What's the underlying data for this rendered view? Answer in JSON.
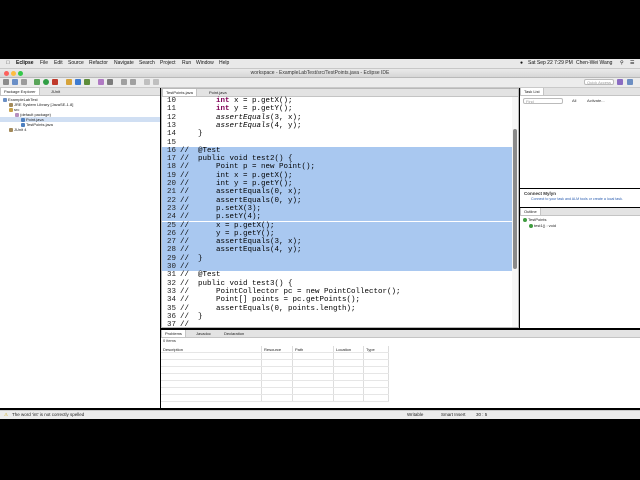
{
  "menubar": {
    "app": "Eclipse",
    "items": [
      "File",
      "Edit",
      "Source",
      "Refactor",
      "Navigate",
      "Search",
      "Project",
      "Run",
      "Window",
      "Help"
    ],
    "datetime": "Sat Sep 22  7:29 PM",
    "user": "Chen-Wei Wang"
  },
  "window": {
    "title": "workspace - ExampleLabTest/src/TestPoints.java - Eclipse IDE"
  },
  "toolbar": {
    "quick_access": "Quick Access"
  },
  "package_explorer": {
    "tab_label": "Package Explorer",
    "tab2_label": "JUnit",
    "tree": [
      "ExampleLabTest",
      "JRE System Library [JavaSE-1.8]",
      "src",
      "(default package)",
      "Point.java",
      "TestPoints.java",
      "JUnit 4"
    ]
  },
  "editor": {
    "tabs": [
      "TestPoints.java",
      "Point.java"
    ],
    "lines": [
      {
        "n": "10",
        "t": "        int x = p.getX();"
      },
      {
        "n": "11",
        "t": "        int y = p.getY();"
      },
      {
        "n": "12",
        "t": "        assertEquals(3, x);"
      },
      {
        "n": "13",
        "t": "        assertEquals(4, y);"
      },
      {
        "n": "14",
        "t": "    }"
      },
      {
        "n": "15",
        "t": ""
      },
      {
        "n": "16",
        "t": "//  @Test"
      },
      {
        "n": "17",
        "t": "//  public void test2() {"
      },
      {
        "n": "18",
        "t": "//      Point p = new Point();"
      },
      {
        "n": "19",
        "t": "//      int x = p.getX();"
      },
      {
        "n": "20",
        "t": "//      int y = p.getY();"
      },
      {
        "n": "21",
        "t": "//      assertEquals(0, x);"
      },
      {
        "n": "22",
        "t": "//      assertEquals(0, y);"
      },
      {
        "n": "23",
        "t": "//      p.setX(3);"
      },
      {
        "n": "24",
        "t": "//      p.setY(4);"
      },
      {
        "n": "25",
        "t": "//      x = p.getX();"
      },
      {
        "n": "26",
        "t": "//      y = p.getY();"
      },
      {
        "n": "27",
        "t": "//      assertEquals(3, x);"
      },
      {
        "n": "28",
        "t": "//      assertEquals(4, y);"
      },
      {
        "n": "29",
        "t": "//  }"
      },
      {
        "n": "30",
        "t": "//"
      },
      {
        "n": "31",
        "t": "//  @Test"
      },
      {
        "n": "32",
        "t": "//  public void test3() {"
      },
      {
        "n": "33",
        "t": "//      PointCollector pc = new PointCollector();"
      },
      {
        "n": "34",
        "t": "//      Point[] points = pc.getPoints();"
      },
      {
        "n": "35",
        "t": "//      assertEquals(0, points.length);"
      },
      {
        "n": "36",
        "t": "//  }"
      },
      {
        "n": "37",
        "t": "//"
      }
    ]
  },
  "task_list": {
    "tab_label": "Task List",
    "find_placeholder": "Find",
    "filter_all": "All",
    "activate": "Activate..."
  },
  "mylyn": {
    "title": "Connect Mylyn",
    "body": "Connect to your task and ALM tools or create a local task."
  },
  "outline": {
    "tab_label": "Outline",
    "root": "TestPoints",
    "item": "test1() : void"
  },
  "problems": {
    "tabs": [
      "Problems",
      "Javadoc",
      "Declaration"
    ],
    "count": "0 items",
    "columns": [
      "Description",
      "Resource",
      "Path",
      "Location",
      "Type"
    ]
  },
  "status": {
    "message": "The word 'int' is not correctly spelled",
    "mode": "Writable",
    "insert": "Smart Insert",
    "position": "30 : 5"
  }
}
